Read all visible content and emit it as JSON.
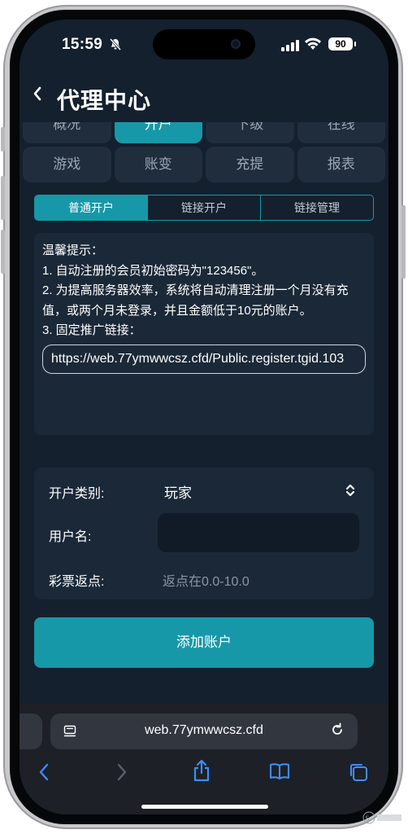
{
  "status_bar": {
    "time": "15:59",
    "battery": "90",
    "silent_icon": "bell-slash-icon"
  },
  "header": {
    "back_icon": "chevron-left-icon",
    "title": "代理中心"
  },
  "nav": {
    "row1": [
      "概况",
      "开户",
      "下级",
      "在线"
    ],
    "row1_active": "开户",
    "row2": [
      "游戏",
      "账变",
      "充提",
      "报表"
    ]
  },
  "segmented": {
    "items": [
      "普通开户",
      "链接开户",
      "链接管理"
    ],
    "active": "普通开户"
  },
  "tips": {
    "title": "温馨提示：",
    "line1": "1. 自动注册的会员初始密码为\"123456\"。",
    "line2": "2. 为提高服务器效率，系统将自动清理注册一个月没有充值，或两个月未登录，并且金额低于10元的账户。",
    "line3": "3. 固定推广链接：",
    "link": "https://web.77ymwwcsz.cfd/Public.register.tgid.103"
  },
  "form": {
    "account_type_label": "开户类别:",
    "account_type_value": "玩家",
    "username_label": "用户名:",
    "username_value": "",
    "rebate_label": "彩票返点:",
    "rebate_placeholder": "返点在0.0-10.0"
  },
  "submit_label": "添加账户",
  "browser": {
    "url": "web.77ymwwcsz.cfd",
    "toolbar_icons": [
      "back-icon",
      "forward-icon",
      "share-icon",
      "bookmarks-icon",
      "tabs-icon"
    ]
  },
  "colors": {
    "accent": "#1798a8",
    "background": "#14202e",
    "card": "#1b2838"
  }
}
